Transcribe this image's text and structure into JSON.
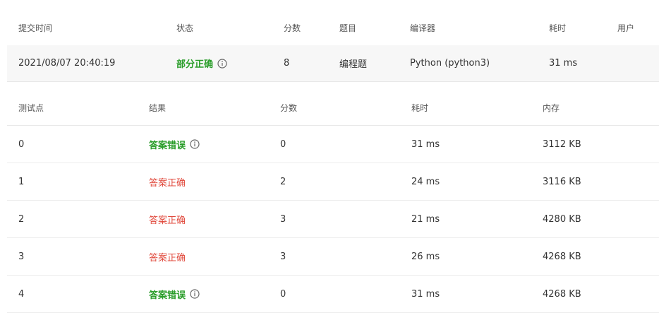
{
  "submission": {
    "headers": {
      "submit_time": "提交时间",
      "status": "状态",
      "score": "分数",
      "problem": "题目",
      "compiler": "编译器",
      "time": "耗时",
      "user": "用户"
    },
    "row": {
      "submit_time": "2021/08/07 20:40:19",
      "status": "部分正确",
      "score": "8",
      "problem": "编程题",
      "compiler": "Python (python3)",
      "time": "31 ms",
      "user": ""
    }
  },
  "testcases": {
    "headers": {
      "point": "测试点",
      "result": "结果",
      "score": "分数",
      "time": "耗时",
      "memory": "内存"
    },
    "rows": [
      {
        "point": "0",
        "result": "答案错误",
        "result_kind": "green",
        "has_info": true,
        "score": "0",
        "time": "31 ms",
        "memory": "3112 KB"
      },
      {
        "point": "1",
        "result": "答案正确",
        "result_kind": "red",
        "has_info": false,
        "score": "2",
        "time": "24 ms",
        "memory": "3116 KB"
      },
      {
        "point": "2",
        "result": "答案正确",
        "result_kind": "red",
        "has_info": false,
        "score": "3",
        "time": "21 ms",
        "memory": "4280 KB"
      },
      {
        "point": "3",
        "result": "答案正确",
        "result_kind": "red",
        "has_info": false,
        "score": "3",
        "time": "26 ms",
        "memory": "4268 KB"
      },
      {
        "point": "4",
        "result": "答案错误",
        "result_kind": "green",
        "has_info": true,
        "score": "0",
        "time": "31 ms",
        "memory": "4268 KB"
      }
    ]
  },
  "colors": {
    "green": "#2a9d2a",
    "red": "#e0473a",
    "row_bg": "#f7f7f7"
  },
  "icons": {
    "info": "info-circle-icon"
  }
}
